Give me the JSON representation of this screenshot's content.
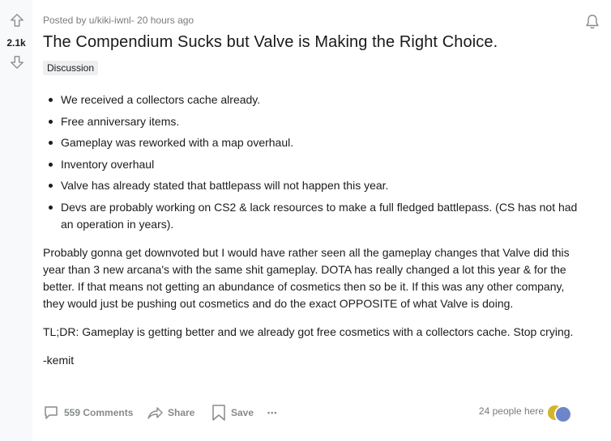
{
  "post": {
    "meta": "Posted by u/kiki-iwnl- 20 hours ago",
    "score": "2.1k",
    "title": "The Compendium Sucks but Valve is Making the Right Choice.",
    "flair": "Discussion",
    "bullets": [
      "We received a collectors cache already.",
      "Free anniversary items.",
      "Gameplay was reworked with a map overhaul.",
      "Inventory overhaul",
      "Valve has already stated that battlepass will not happen this year.",
      "Devs are probably working on CS2 & lack resources to make a full fledged battlepass. (CS has not had an operation in years)."
    ],
    "paragraphs": [
      "Probably gonna get downvoted but I would have rather seen all the gameplay changes that Valve did this year than 3 new arcana's with the same shit gameplay. DOTA has really changed a lot this year & for the better. If that means not getting an abundance of cosmetics then so be it. If this was any other company, they would just be pushing out cosmetics and do the exact OPPOSITE of what Valve is doing.",
      "TL;DR: Gameplay is getting better and we already got free cosmetics with a collectors cache. Stop crying.",
      "-kemit"
    ]
  },
  "actions": {
    "comments": "559 Comments",
    "share": "Share",
    "save": "Save",
    "more": "•••",
    "people_here": "24 people here"
  },
  "icons": {
    "upvote": "upvote-arrow-icon",
    "downvote": "downvote-arrow-icon",
    "bell": "bell-icon",
    "comment": "comment-bubble-icon",
    "share": "share-arrow-icon",
    "save": "bookmark-icon"
  },
  "colors": {
    "vote_column": "#f8f9fa",
    "meta_text": "#787c7e",
    "action_text": "#878a8c",
    "flair_bg": "#edeff1"
  }
}
